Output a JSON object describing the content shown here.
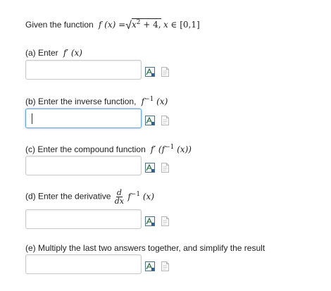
{
  "intro": {
    "text": "Given the function",
    "formula_lhs": "f (x) =",
    "formula_sqrt_body": "x2 + 4,",
    "formula_domain": "x ∈ [0,1]"
  },
  "parts": [
    {
      "label": "(a) Enter",
      "formula": "f′ (x)"
    },
    {
      "label": "(b) Enter the inverse function,",
      "formula": "f−1 (x)"
    },
    {
      "label": "(c) Enter the compound function",
      "formula": "f′ (f−1 (x))"
    },
    {
      "label": "(d) Enter the derivative",
      "formula_frac_num": "d",
      "formula_frac_den": "dx",
      "formula": "f−1 (x)"
    },
    {
      "label": "(e) Multiply the last two answers together, and simplify the result"
    }
  ],
  "icons": [
    "equation-editor-icon",
    "preview-icon"
  ]
}
